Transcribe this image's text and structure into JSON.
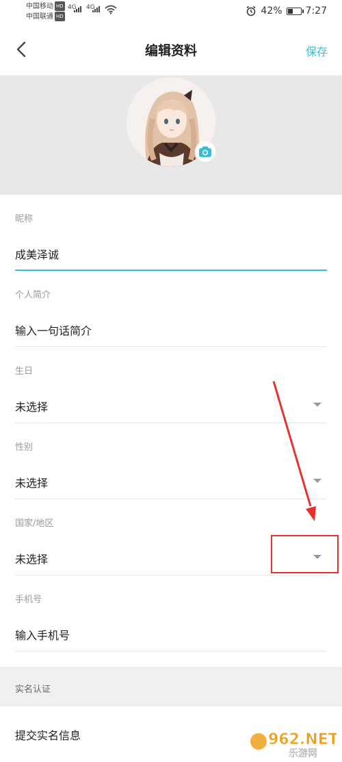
{
  "status_bar": {
    "carrier_1": "中国移动",
    "carrier_2": "中国联通",
    "hd_badge": "HD",
    "network_1": "4G",
    "network_2": "4G",
    "battery_text": "42%",
    "battery_level": 0.42,
    "time": "7:27"
  },
  "header": {
    "title": "编辑资料",
    "save_label": "保存"
  },
  "colors": {
    "accent": "#3bbcd0",
    "annotation_red": "#e8312d"
  },
  "form": {
    "nickname": {
      "label": "昵称",
      "value": "成美泽诚"
    },
    "bio": {
      "label": "个人简介",
      "placeholder": "输入一句话简介"
    },
    "birthday": {
      "label": "生日",
      "value": "未选择"
    },
    "gender": {
      "label": "性别",
      "value": "未选择"
    },
    "region": {
      "label": "国家/地区",
      "value": "未选择"
    },
    "phone": {
      "label": "手机号",
      "placeholder": "输入手机号"
    }
  },
  "realname": {
    "section_title": "实名认证",
    "item_label": "提交实名信息"
  },
  "watermark": {
    "brand": "962.NET",
    "sub": "乐游网"
  }
}
